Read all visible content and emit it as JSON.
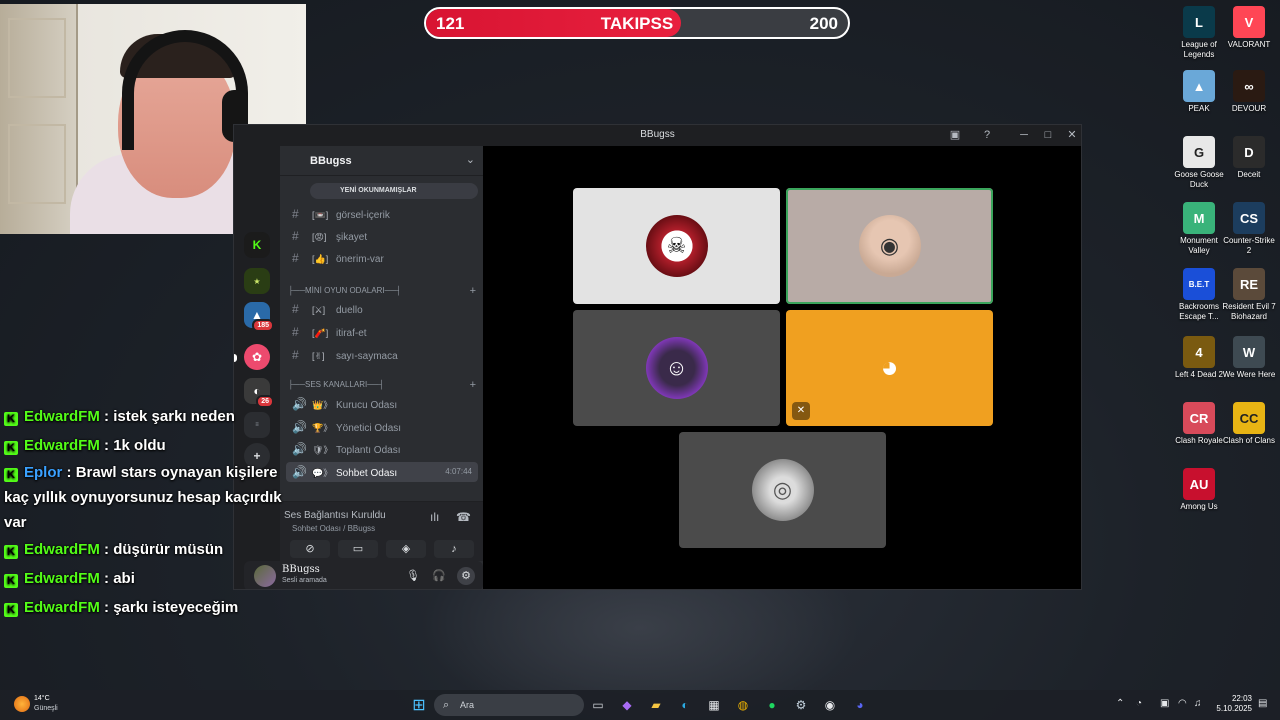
{
  "goal": {
    "current": "121",
    "label": "TAKIPSS",
    "target": "200",
    "progress_fraction": 0.605
  },
  "desktop_icons": [
    {
      "label": "League of Legends",
      "color": "#0a3a4a",
      "glyph": "L"
    },
    {
      "label": "VALORANT",
      "color": "#ff4655",
      "glyph": "V"
    },
    {
      "label": "PEAK",
      "color": "#6aa8d8",
      "glyph": "▲"
    },
    {
      "label": "DEVOUR",
      "color": "#2a1a12",
      "glyph": "∞"
    },
    {
      "label": "Goose Goose Duck",
      "color": "#e8e8e8",
      "glyph": "G"
    },
    {
      "label": "Deceit",
      "color": "#2b2b2b",
      "glyph": "D"
    },
    {
      "label": "Monument Valley",
      "color": "#39b37a",
      "glyph": "M"
    },
    {
      "label": "Counter-Strike 2",
      "color": "#1c3d5e",
      "glyph": "CS"
    },
    {
      "label": "Backrooms Escape T...",
      "color": "#1a4fd8",
      "glyph": "B.E.T"
    },
    {
      "label": "Resident Evil 7 Biohazard",
      "color": "#5b4a3a",
      "glyph": "RE"
    },
    {
      "label": "Left 4 Dead 2",
      "color": "#7a5a10",
      "glyph": "4"
    },
    {
      "label": "We Were Here",
      "color": "#3e4a52",
      "glyph": "W"
    },
    {
      "label": "Clash Royale",
      "color": "#d84a5a",
      "glyph": "CR"
    },
    {
      "label": "Clash of Clans",
      "color": "#e8b414",
      "glyph": "CC"
    },
    {
      "label": "Among Us",
      "color": "#c8102e",
      "glyph": "AU"
    }
  ],
  "discord": {
    "window_title": "BBugss",
    "guild_name": "BBugss",
    "unread_label": "YENİ OKUNMAMIŞLAR",
    "server_badges": {
      "s4": "185",
      "s6": "26"
    },
    "channels_top": [
      {
        "name": "görsel-içerik",
        "emoji": "[📼]"
      },
      {
        "name": "şikayet",
        "emoji": "[😡]"
      },
      {
        "name": "önerim-var",
        "emoji": "[👍]"
      }
    ],
    "category_games": "├──MİNİ OYUN ODALARI──┤",
    "channels_games": [
      {
        "name": "duello",
        "emoji": "[⚔]"
      },
      {
        "name": "itiraf-et",
        "emoji": "[🧨]"
      },
      {
        "name": "sayı-saymaca",
        "emoji": "[✌]"
      }
    ],
    "category_voice": "├──SES KANALLARI──┤",
    "voice_channels": [
      {
        "name": "Kurucu Odası",
        "emoji": "👑》"
      },
      {
        "name": "Yönetici Odası",
        "emoji": "🏆》"
      },
      {
        "name": "Toplantı Odası",
        "emoji": "🛡》"
      },
      {
        "name": "Sohbet Odası",
        "emoji": "💬》",
        "time": "4:07:44"
      }
    ],
    "voice_status": {
      "title": "Ses Bağlantısı Kuruldu",
      "sub": "Sohbet Odası / BBugss"
    },
    "user": {
      "name": "BBugss",
      "state": "Sesli aramada"
    },
    "colors": {
      "stage_bg": "#000000",
      "speaking": "#3ba55c",
      "discord_tile": "#f0a020"
    }
  },
  "chat": [
    {
      "user": "EdwardFM",
      "sep": " : ",
      "text": "istek şarkı neden",
      "blue": false
    },
    {
      "user": "EdwardFM",
      "sep": " : ",
      "text": "1k oldu",
      "blue": false
    },
    {
      "user": "Eplor",
      "sep": " : ",
      "text": "Brawl stars oynayan kişilere kaç yıllık oynuyorsunuz hesap kaçırdık var",
      "blue": true
    },
    {
      "user": "EdwardFM",
      "sep": " : ",
      "text": "düşürür müsün",
      "blue": false
    },
    {
      "user": "EdwardFM",
      "sep": " : ",
      "text": "abi",
      "blue": false
    },
    {
      "user": "EdwardFM",
      "sep": " : ",
      "text": "şarkı isteyeceğim",
      "blue": false
    }
  ],
  "taskbar": {
    "weather_temp": "14°C",
    "weather_desc": "Güneşli",
    "search_placeholder": "Ara",
    "time": "22:03",
    "date": "5.10.2025"
  }
}
